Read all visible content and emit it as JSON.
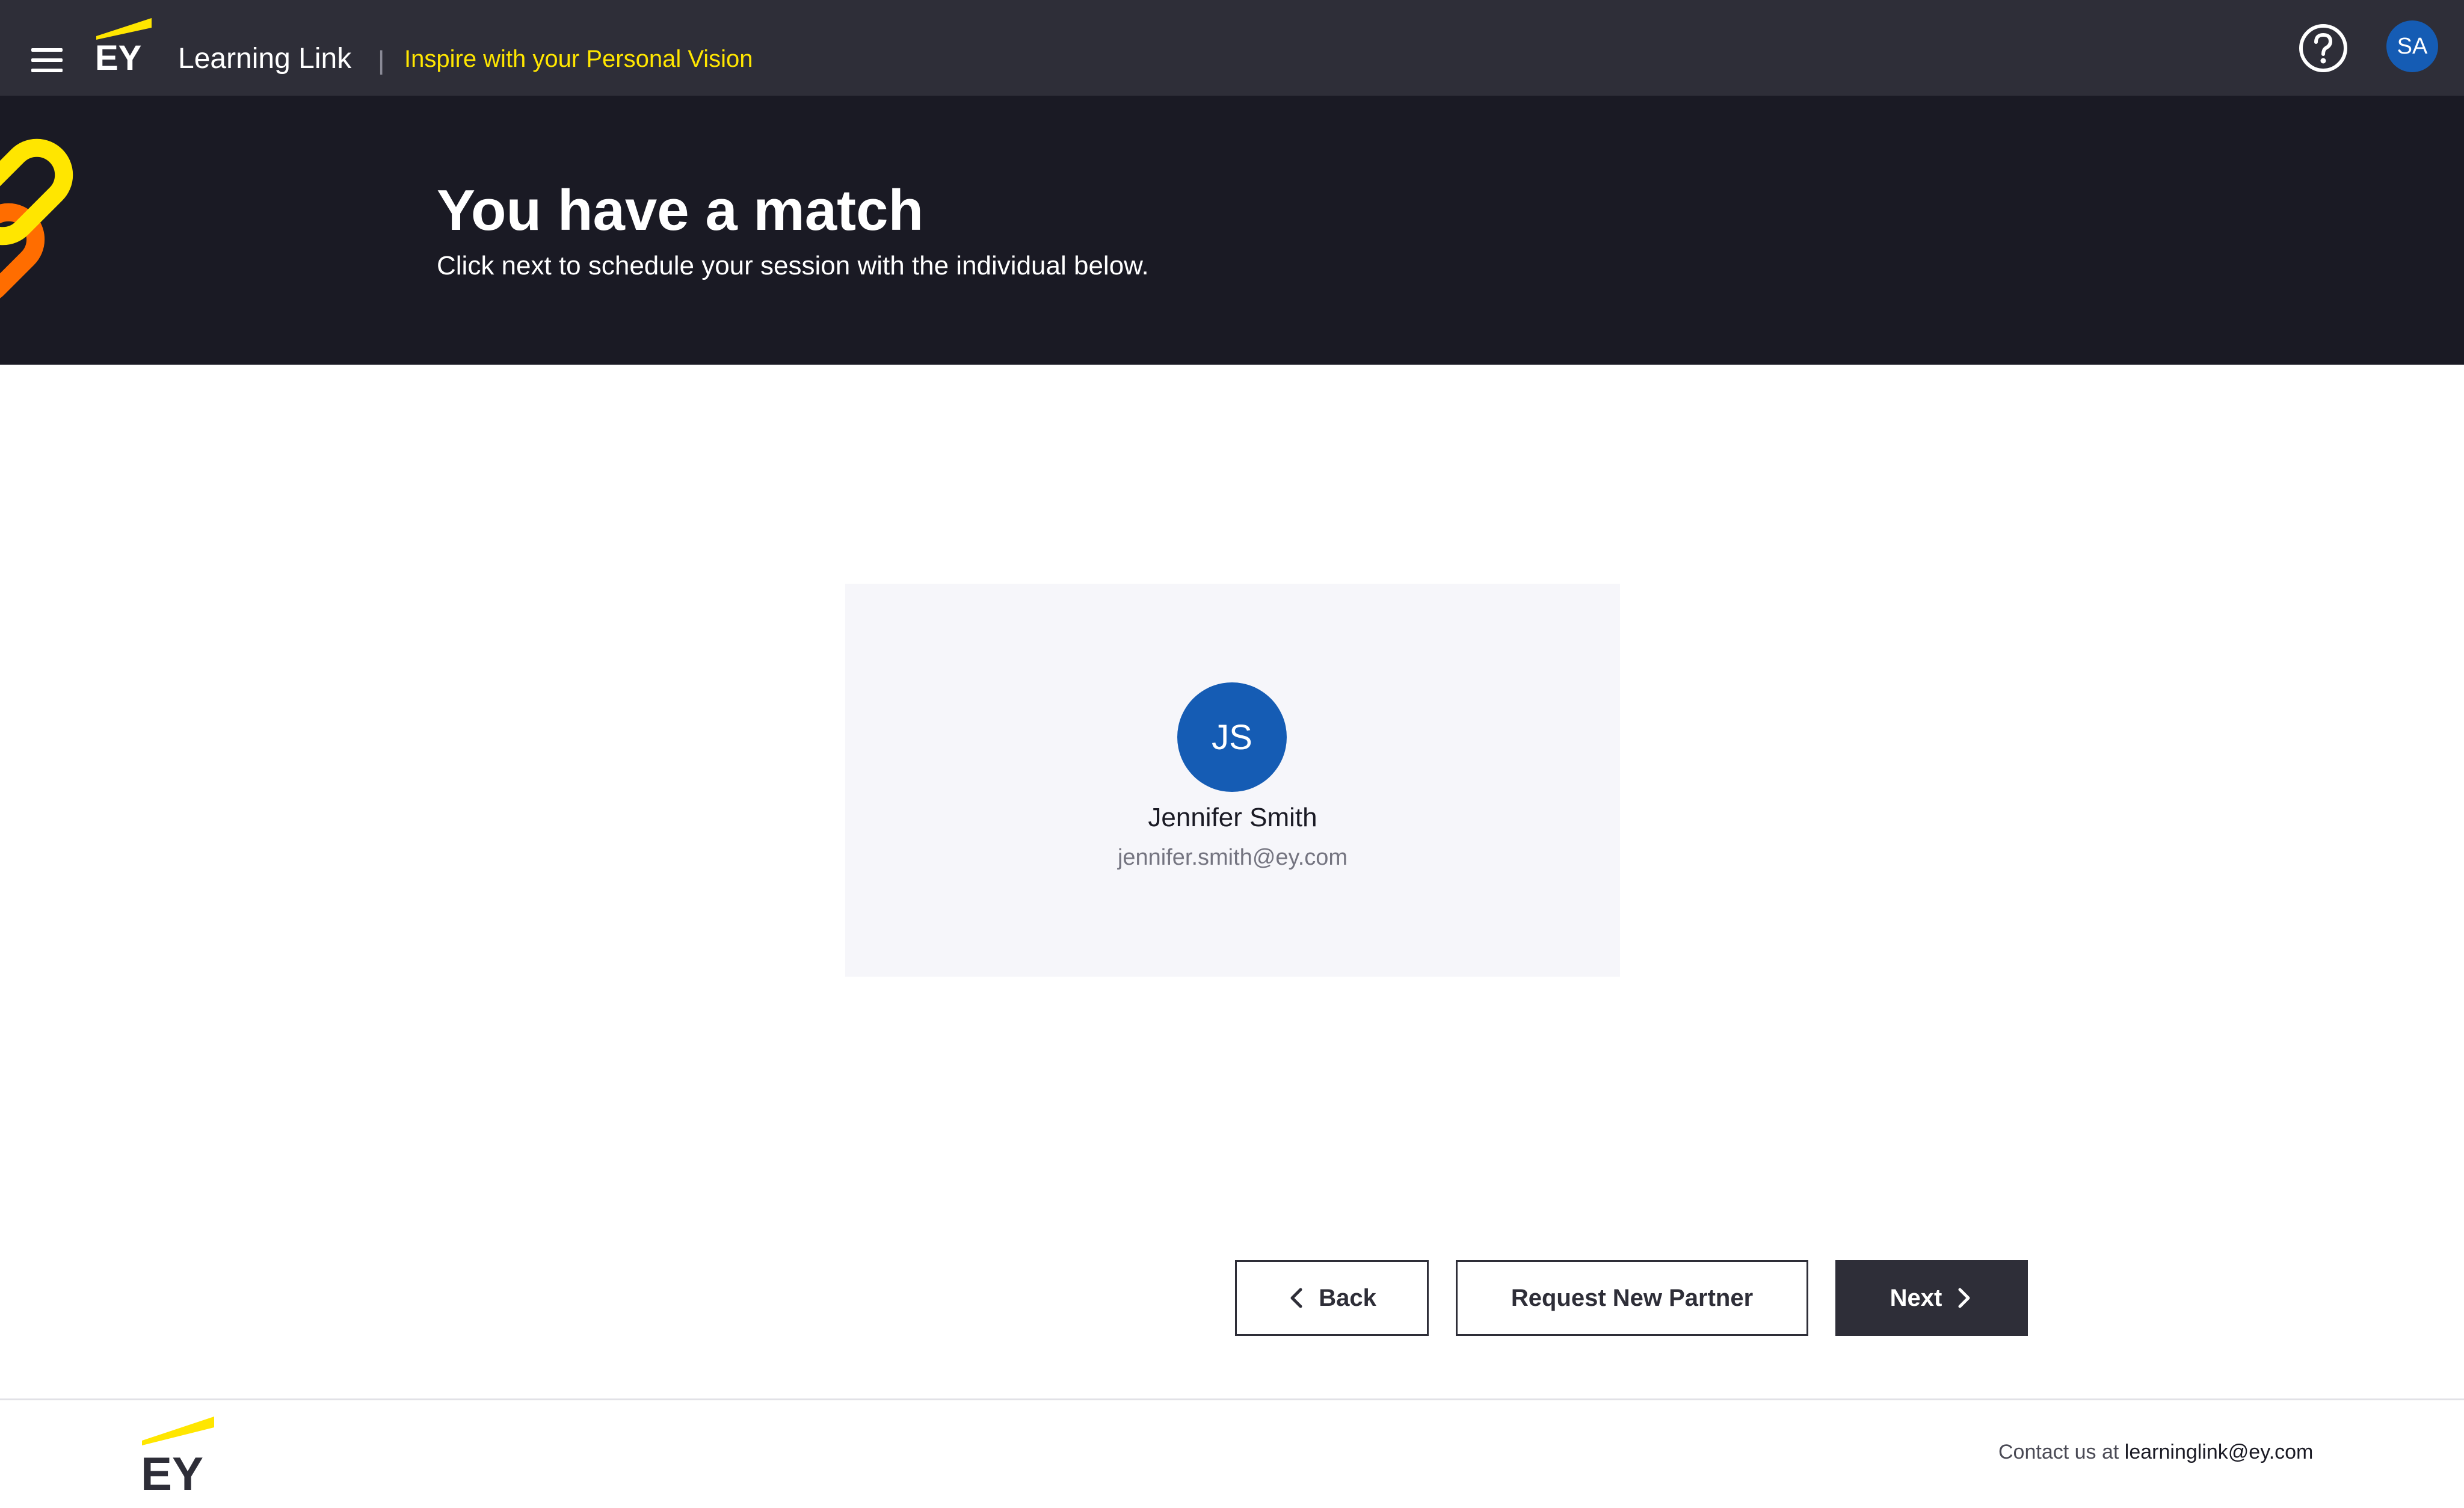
{
  "header": {
    "brand": "EY",
    "app_title": "Learning Link",
    "separator": "|",
    "tagline": "Inspire with your Personal Vision",
    "user_initials": "SA"
  },
  "hero": {
    "title": "You have a match",
    "subtitle": "Click next to schedule your session with the individual below."
  },
  "match": {
    "initials": "JS",
    "name": "Jennifer Smith",
    "email": "jennifer.smith@ey.com"
  },
  "actions": {
    "back_label": "Back",
    "request_label": "Request New Partner",
    "next_label": "Next"
  },
  "footer": {
    "brand": "EY",
    "contact_prefix": "Contact us at",
    "contact_email": "learninglink@ey.com"
  },
  "colors": {
    "topbar": "#2e2e38",
    "hero": "#1a1a24",
    "accent_yellow": "#ffe600",
    "avatar_blue": "#155cb4",
    "card_bg": "#f6f6fa"
  },
  "icons": [
    "hamburger-menu-icon",
    "help-icon",
    "chevron-left-icon",
    "chevron-right-icon",
    "chain-link-decoration"
  ]
}
